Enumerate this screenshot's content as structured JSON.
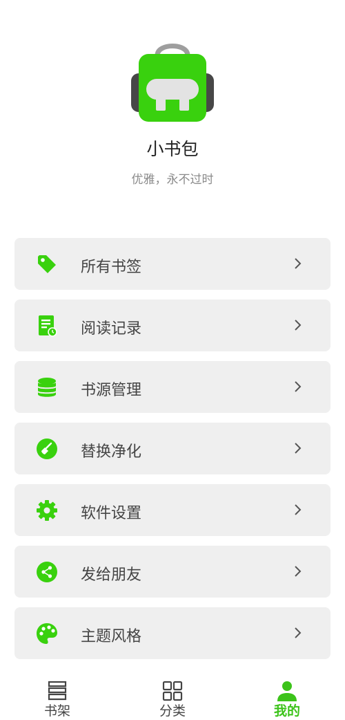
{
  "app": {
    "title": "小书包",
    "subtitle": "优雅，永不过时"
  },
  "colors": {
    "accent": "#39d10e",
    "card": "#efefef"
  },
  "menu": [
    {
      "label": "所有书签",
      "icon": "bookmark-tag-icon"
    },
    {
      "label": "阅读记录",
      "icon": "reading-history-icon"
    },
    {
      "label": "书源管理",
      "icon": "database-icon"
    },
    {
      "label": "替换净化",
      "icon": "broom-icon"
    },
    {
      "label": "软件设置",
      "icon": "gear-icon"
    },
    {
      "label": "发给朋友",
      "icon": "share-icon"
    },
    {
      "label": "主题风格",
      "icon": "palette-icon"
    }
  ],
  "nav": [
    {
      "label": "书架",
      "icon": "bookshelf-icon",
      "active": false
    },
    {
      "label": "分类",
      "icon": "grid-icon",
      "active": false
    },
    {
      "label": "我的",
      "icon": "person-icon",
      "active": true
    }
  ]
}
